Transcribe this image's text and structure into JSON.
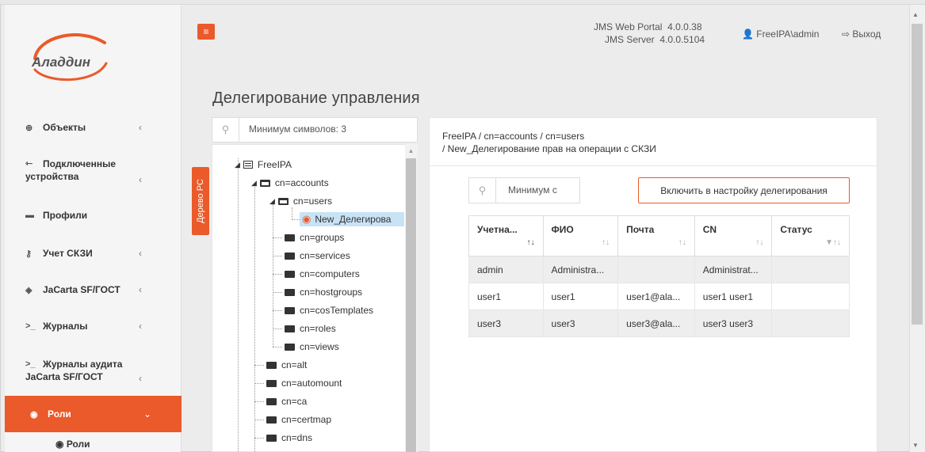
{
  "logo_text": "Аладдин",
  "header": {
    "menu_icon": "≡",
    "portal_label": "JMS Web Portal",
    "portal_version": "4.0.0.38",
    "server_label": "JMS Server",
    "server_version": "4.0.0.5104",
    "user": "FreeIPA\\admin",
    "logout": "Выход"
  },
  "sidebar": {
    "items": [
      {
        "label": "Объекты",
        "icon": "objects-icon"
      },
      {
        "label1": "Подключенные",
        "label2": "устройства",
        "icon": "devices-icon"
      },
      {
        "label": "Профили",
        "icon": "folder-icon"
      },
      {
        "label": "Учет СКЗИ",
        "icon": "key-icon"
      },
      {
        "label": "JaCarta SF/ГОСТ",
        "icon": "shield-icon"
      },
      {
        "label": "Журналы",
        "icon": "terminal-icon"
      },
      {
        "label1": "Журналы аудита",
        "label2": "JaCarta SF/ГОСТ",
        "icon": "terminal-icon"
      },
      {
        "label": "Роли",
        "icon": "user-circle-icon"
      }
    ],
    "sub_item": "Роли"
  },
  "page_title": "Делегирование управления",
  "tree": {
    "tab_label": "Дерево РС",
    "search_placeholder": "Минимум символов: 3",
    "nodes": [
      "FreeIPA",
      "cn=accounts",
      "cn=users",
      "New_Делегирова",
      "cn=groups",
      "cn=services",
      "cn=computers",
      "cn=hostgroups",
      "cn=cosTemplates",
      "cn=roles",
      "cn=views",
      "cn=alt",
      "cn=automount",
      "cn=ca",
      "cn=certmap",
      "cn=dns"
    ]
  },
  "breadcrumb": {
    "line1": "FreeIPA  /  cn=accounts  /  cn=users",
    "line2": "/  New_Делегирование прав на операции с СКЗИ"
  },
  "users": {
    "search_placeholder": "Минимум с",
    "enable_button": "Включить в настройку делегирования",
    "columns": [
      "Учетна...",
      "ФИО",
      "Почта",
      "CN",
      "Статус"
    ],
    "rows": [
      [
        "admin",
        "Administra...",
        "",
        "Administrat...",
        ""
      ],
      [
        "user1",
        "user1",
        "user1@ala...",
        "user1 user1",
        ""
      ],
      [
        "user3",
        "user3",
        "user3@ala...",
        "user3 user3",
        ""
      ]
    ]
  },
  "colors": {
    "accent": "#ea5a2a",
    "selection": "#c8e3f5"
  }
}
